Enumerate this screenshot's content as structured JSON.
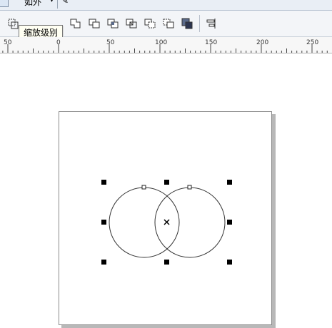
{
  "app": {
    "top_strip": {
      "label": "如外",
      "caret": "▾"
    },
    "tooltip": {
      "text": "缩放级别"
    },
    "toolbar": {
      "icons": [
        "transform-icon",
        "weld-icon",
        "trim-icon",
        "intersect-icon",
        "simplify-icon",
        "front-minus-back-icon",
        "back-minus-front-icon",
        "create-boundary-icon",
        "align-distribute-icon"
      ]
    },
    "ruler": {
      "labels": [
        "50",
        "0",
        "50",
        "100",
        "150",
        "200",
        "250"
      ]
    },
    "colors": {
      "toolbar_bg": "#f3f5f8",
      "tooltip_bg": "#fffff2",
      "page_shadow": "#b8b8b8"
    }
  }
}
